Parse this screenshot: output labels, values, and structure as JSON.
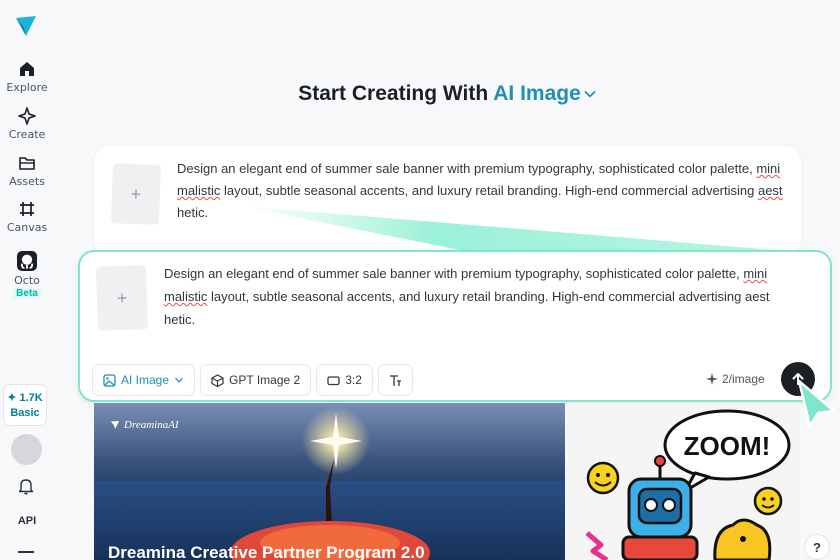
{
  "sidebar": {
    "items": [
      {
        "label": "Explore"
      },
      {
        "label": "Create"
      },
      {
        "label": "Assets"
      },
      {
        "label": "Canvas"
      },
      {
        "label": "Octo",
        "badge": "Beta"
      }
    ],
    "credits": {
      "amount": "✦ 1.7K",
      "plan": "Basic"
    },
    "api_label": "API"
  },
  "heading": {
    "prefix": "Start Creating With ",
    "mode": "AI Image"
  },
  "ghost_prompt": {
    "line1_pre": "Design an elegant end of summer sale banner with premium typography, sophisticated color palette, ",
    "line1_sq": "mini",
    "line2_sq": "malistic",
    "line2_post": " layout, subtle seasonal accents, and luxury retail branding. High-end commercial advertising ",
    "line2_sq2": "aest",
    "line3": "hetic."
  },
  "prompt": {
    "line1_pre": "Design an elegant end of summer sale banner with premium typography, sophisticated color palette, ",
    "line1_sq": "mini",
    "line2_sq": "malistic",
    "line2_post": " layout, subtle seasonal accents, and luxury retail branding. High-end commercial advertising aest",
    "line3": "hetic."
  },
  "toolbar": {
    "mode_label": "AI Image",
    "model_label": "GPT Image 2",
    "ratio_label": "3:2",
    "cost_label": "2/image"
  },
  "gallery": {
    "brand": "DreaminaAI",
    "title": "Dreamina Creative Partner Program 2.0",
    "side_caption": "ZOOM!"
  },
  "help_label": "?",
  "colors": {
    "accent": "#1f8fb5",
    "border_glow": "#7fe5cc",
    "send": "#1c1f23"
  }
}
